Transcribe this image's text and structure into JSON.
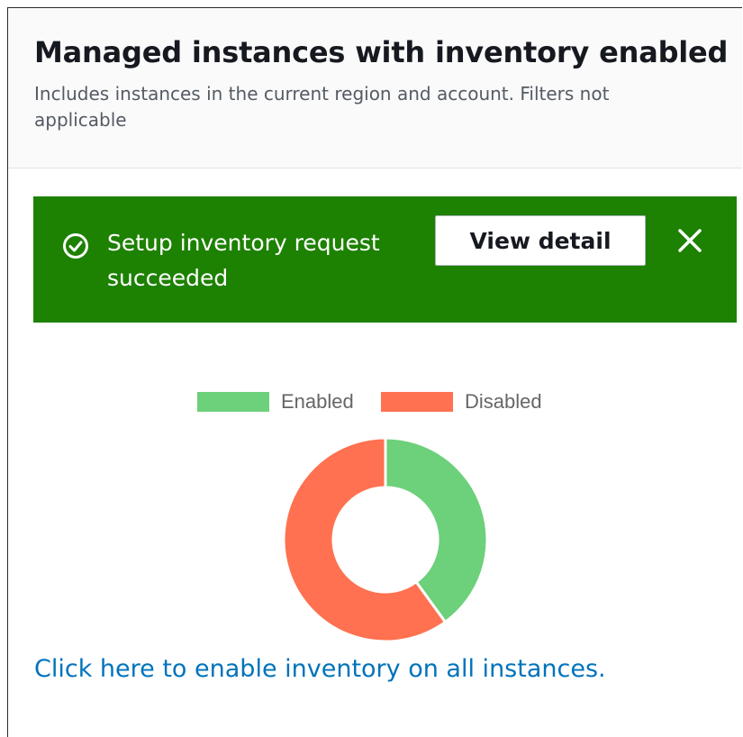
{
  "panel": {
    "title": "Managed instances with inventory enabled",
    "description": "Includes instances in the current region and account. Filters not applicable"
  },
  "flash": {
    "status": "success",
    "icon": "check-circle-icon",
    "message": "Setup inventory request succeeded",
    "action_label": "View detail",
    "dismiss_icon": "close-icon",
    "color": "#1d8102"
  },
  "chart_data": {
    "type": "pie",
    "variant": "doughnut",
    "legend_position": "top",
    "categories": [
      "Enabled",
      "Disabled"
    ],
    "values": [
      40,
      60
    ],
    "colors": [
      "#6dd07a",
      "#ff7150"
    ]
  },
  "footer": {
    "enable_link": "Click here to enable inventory on all instances."
  }
}
